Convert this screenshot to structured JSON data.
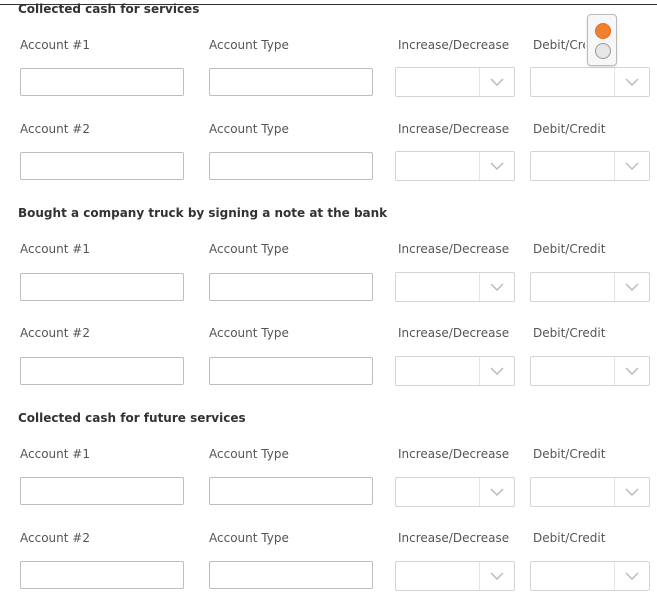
{
  "sections": [
    {
      "title": "Collected cash for services",
      "rows": [
        {
          "account_label": "Account #1",
          "type_label": "Account Type",
          "incdec_label": "Increase/Decrease",
          "debitcredit_label": "Debit/Credit"
        },
        {
          "account_label": "Account #2",
          "type_label": "Account Type",
          "incdec_label": "Increase/Decrease",
          "debitcredit_label": "Debit/Credit"
        }
      ]
    },
    {
      "title": "Bought a company truck by signing a note at the bank",
      "rows": [
        {
          "account_label": "Account #1",
          "type_label": "Account Type",
          "incdec_label": "Increase/Decrease",
          "debitcredit_label": "Debit/Credit"
        },
        {
          "account_label": "Account #2",
          "type_label": "Account Type",
          "incdec_label": "Increase/Decrease",
          "debitcredit_label": "Debit/Credit"
        }
      ]
    },
    {
      "title": "Collected cash for future services",
      "rows": [
        {
          "account_label": "Account #1",
          "type_label": "Account Type",
          "incdec_label": "Increase/Decrease",
          "debitcredit_label": "Debit/Credit"
        },
        {
          "account_label": "Account #2",
          "type_label": "Account Type",
          "incdec_label": "Increase/Decrease",
          "debitcredit_label": "Debit/Credit"
        }
      ]
    }
  ],
  "colors": {
    "toggle_active": "#f08030"
  },
  "icons": {
    "select_arrow": "chevron-down-icon",
    "toggle": "toggle-switch-icon"
  }
}
